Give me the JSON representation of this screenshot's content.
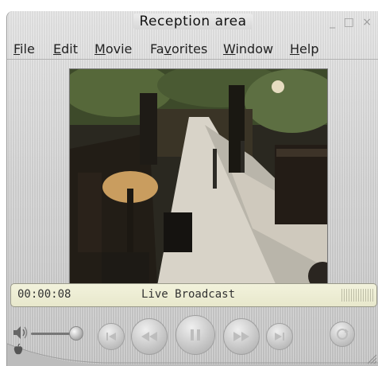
{
  "window": {
    "title": "Reception area",
    "controls": "_ □ ×"
  },
  "menu": [
    {
      "label": "File",
      "mnemonic": "F",
      "rest": "ile"
    },
    {
      "label": "Edit",
      "mnemonic": "E",
      "rest": "dit"
    },
    {
      "label": "Movie",
      "mnemonic": "M",
      "rest": "ovie"
    },
    {
      "label": "Favorites",
      "pre": "Fa",
      "mnemonic": "v",
      "rest": "orites"
    },
    {
      "label": "Window",
      "mnemonic": "W",
      "rest": "indow"
    },
    {
      "label": "Help",
      "mnemonic": "H",
      "rest": "elp"
    }
  ],
  "status": {
    "time": "00:00:08",
    "text": "Live Broadcast"
  },
  "icons": {
    "volume": "speaker-icon",
    "rewind_start": "skip-back-icon",
    "rewind": "rewind-icon",
    "pause": "pause-icon",
    "forward": "fast-forward-icon",
    "forward_end": "skip-forward-icon",
    "resize": "resize-icon",
    "apple": "apple-logo"
  },
  "colors": {
    "status_bg": "#f0f0d8",
    "chrome": "#d2d2d2"
  }
}
